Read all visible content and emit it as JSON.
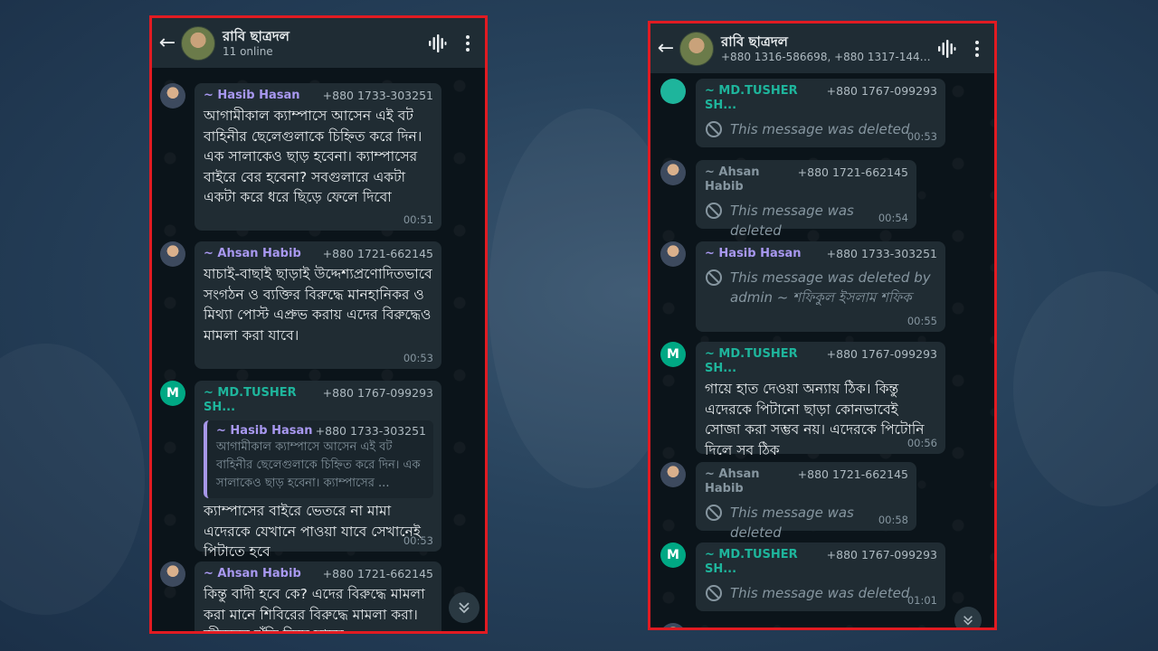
{
  "left_phone": {
    "header": {
      "title": "রাবি ছাত্রদল",
      "subtitle": "11 online"
    },
    "messages": [
      {
        "sender": "~ Hasib Hasan",
        "phone": "+880 1733-303251",
        "text": "আগামীকাল ক্যাম্পাসে আসেন এই বট বাহিনীর ছেলেগুলাকে চিহ্নিত করে দিন। এক সালাকেও ছাড় হবেনা। ক্যাম্পাসের বাইরে বের হবেনা? সবগুলারে একটা একটা করে ধরে ছিড়ে ফেলে দিবো",
        "time": "00:51"
      },
      {
        "sender": "~ Ahsan Habib",
        "phone": "+880 1721-662145",
        "text": "যাচাই-বাছাই ছাড়াই উদ্দেশ্যপ্রণোদিতভাবে সংগঠন ও ব্যক্তির বিরুদ্ধে মানহানিকর ও মিথ্যা পোস্ট এপ্রুভ করায় এদের বিরুদ্ধেও মামলা করা যাবে।",
        "time": "00:53"
      },
      {
        "avatar_letter": "M",
        "sender": "~ MD.TUSHER SH...",
        "phone": "+880 1767-099293",
        "quote": {
          "sender": "~ Hasib Hasan",
          "phone": "+880 1733-303251",
          "text": "আগামীকাল ক্যাম্পাসে আসেন এই বট বাহিনীর ছেলেগুলাকে চিহ্নিত করে দিন। এক সালাকেও ছাড় হবেনা। ক্যাম্পাসের ..."
        },
        "text": "ক্যাম্পাসের বাইরে ভেতরে না মামা এদেরকে যেখানে পাওয়া যাবে সেখানেই পিটাতে হবে",
        "time": "00:53"
      },
      {
        "sender": "~ Ahsan Habib",
        "phone": "+880 1721-662145",
        "text": "কিন্তু বাদী হবে কে? এদের বিরুদ্ধে মামলা করা মানে শিবিরের বিরুদ্ধে মামলা করা। জীবনের ঝুঁকি নিয়ে সাহস"
      }
    ]
  },
  "right_phone": {
    "header": {
      "title": "রাবি ছাত্রদল",
      "subtitle": "+880 1316-586698, +880 1317-1443..."
    },
    "messages": [
      {
        "sender": "~ MD.TUSHER SH...",
        "phone": "+880 1767-099293",
        "deleted_text": "This message was deleted",
        "time": "00:53"
      },
      {
        "sender": "~ Ahsan Habib",
        "phone": "+880 1721-662145",
        "deleted_text": "This message was deleted",
        "time": "00:54"
      },
      {
        "sender": "~ Hasib Hasan",
        "phone": "+880 1733-303251",
        "deleted_text": "This message was deleted by admin ~ শফিকুল ইসলাম শফিক",
        "time": "00:55"
      },
      {
        "avatar_letter": "M",
        "sender": "~ MD.TUSHER SH...",
        "phone": "+880 1767-099293",
        "text": "গায়ে হাত দেওয়া অন্যায় ঠিক। কিন্তু এদেরকে পিটানো ছাড়া কোনভাবেই সোজা করা সম্ভব নয়। এদেরকে পিটোনি দিলে সব ঠিক",
        "time": "00:56"
      },
      {
        "sender": "~ Ahsan Habib",
        "phone": "+880 1721-662145",
        "deleted_text": "This message was deleted",
        "time": "00:58"
      },
      {
        "avatar_letter": "M",
        "sender": "~ MD.TUSHER SH...",
        "phone": "+880 1767-099293",
        "deleted_text": "This message was deleted",
        "time": "01:01"
      }
    ]
  },
  "colors": {
    "frame_border": "#e11b22",
    "bubble": "#202c33",
    "chat_bg": "#0b141a",
    "header_bg": "#1f2c34"
  }
}
